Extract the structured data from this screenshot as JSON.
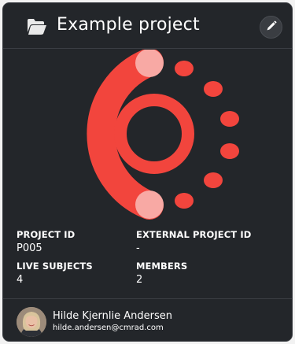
{
  "project": {
    "title": "Example project",
    "icon": "folder-open-icon",
    "edit_icon": "pencil-icon"
  },
  "colors": {
    "card_background": "#23262a",
    "logo_red": "#f2453d",
    "logo_pink": "#f8a9a4",
    "edit_button": "#3a3d42"
  },
  "logo": {
    "name": "project-logo"
  },
  "details": {
    "project_id_label": "PROJECT ID",
    "project_id_value": "P005",
    "external_id_label": "EXTERNAL PROJECT ID",
    "external_id_value": "-",
    "live_subjects_label": "LIVE SUBJECTS",
    "live_subjects_value": "4",
    "members_label": "MEMBERS",
    "members_value": "2"
  },
  "owner": {
    "name": "Hilde Kjernlie Andersen",
    "email": "hilde.andersen@cmrad.com",
    "avatar": "user-avatar"
  }
}
